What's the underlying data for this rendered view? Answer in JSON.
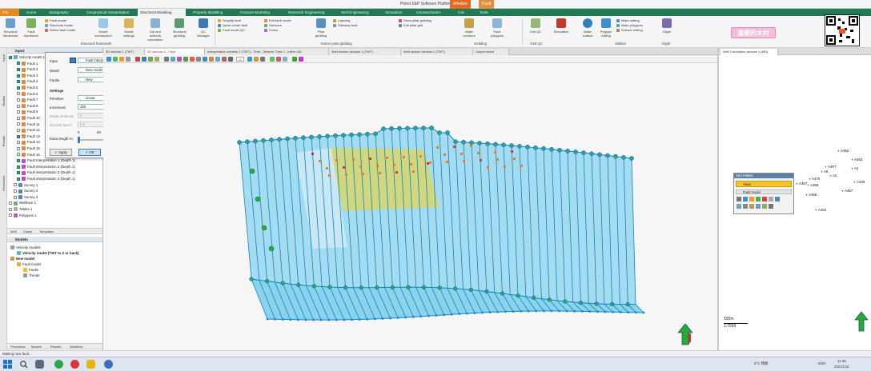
{
  "title_bar": {
    "title": "Petrel E&P Software Platform - [Video1]",
    "context_tab": "Window",
    "context_tab2": "Fault"
  },
  "menu": {
    "tabs": [
      "File",
      "Home",
      "Stratigraphy",
      "Geophysical interpretation",
      "Structural Modeling",
      "Property Modeling",
      "Fracture Modeling",
      "Reservoir Engineering",
      "Well Engineering",
      "Simulation",
      "Geomechanics",
      "GIS",
      "Tools"
    ]
  },
  "ribbon": {
    "buttons": [
      {
        "label": "Structural framework"
      },
      {
        "label": "Fault framework"
      },
      {
        "label": "Model"
      },
      {
        "label": "Model construction"
      },
      {
        "label": "Model settings"
      },
      {
        "label": "Dip and azimuth calculation"
      },
      {
        "label": "Structural gridding"
      },
      {
        "label": "QC Manager"
      }
    ],
    "small_items": [
      "Fault model",
      "Structural model",
      "Define fault model",
      "Simplify fault",
      "Quick create fault",
      "Fault model QC",
      "Edit fault model",
      "Pillar gridding",
      "Horizons",
      "Zones",
      "Layering",
      "Stairstep fault",
      "Show pillar gridding",
      "Edit pillar grid",
      "Make contours",
      "Fault polygons",
      "Surface editing",
      "Make polygons"
    ],
    "big_right": [
      {
        "label": "Pillar gridding"
      },
      {
        "label": "Grid QC"
      },
      {
        "label": "Simulation"
      },
      {
        "label": "Make surface"
      },
      {
        "label": "Polygon editing"
      },
      {
        "label": "Make editing"
      },
      {
        "label": "Glyph"
      }
    ],
    "groups": [
      "Structural framework",
      "Corner point gridding",
      "Gridding",
      "Grid QC",
      "Utilities",
      "Glyph"
    ]
  },
  "watermark": "温暖的木村",
  "side_strip": [
    "Input",
    "Models",
    "Results",
    "Processes"
  ],
  "input_panel": {
    "title": "Input",
    "items": [
      {
        "label": "Velocity model 1 (Depth 1)",
        "checked": true
      },
      {
        "label": "Fault 1",
        "checked": true
      },
      {
        "label": "Fault 2",
        "checked": true
      },
      {
        "label": "Fault 3",
        "checked": true
      },
      {
        "label": "Fault 4",
        "checked": true
      },
      {
        "label": "Fault 5",
        "checked": true
      },
      {
        "label": "Fault 6",
        "checked": false
      },
      {
        "label": "Fault 7",
        "checked": false
      },
      {
        "label": "Fault 8",
        "checked": false
      },
      {
        "label": "Fault 9",
        "checked": false
      },
      {
        "label": "Fault 10",
        "checked": false
      },
      {
        "label": "Fault 11",
        "checked": false
      },
      {
        "label": "Fault 12",
        "checked": false
      },
      {
        "label": "Fault 13",
        "checked": true
      },
      {
        "label": "Fault 14",
        "checked": false
      },
      {
        "label": "Fault 15",
        "checked": false
      },
      {
        "label": "Fault 16",
        "checked": false
      },
      {
        "label": "Fault Interpretation 1 (Depth 1)",
        "checked": true
      },
      {
        "label": "Fault interpretation 2 (Depth 1)",
        "checked": true
      },
      {
        "label": "Fault interpretation 3 (Depth 1)",
        "checked": true
      },
      {
        "label": "Fault interpretation 4 (Depth 1)",
        "checked": true
      },
      {
        "label": "Survey 1",
        "checked": false
      },
      {
        "label": "Survey 2",
        "checked": false
      },
      {
        "label": "Survey 3",
        "checked": false
      },
      {
        "label": "Wellbore 1",
        "checked": false
      },
      {
        "label": "Tables 1",
        "checked": false
      },
      {
        "label": "Polygons 1",
        "checked": false
      }
    ],
    "tabs": [
      "Well",
      "Cases",
      "Templates"
    ]
  },
  "models_panel": {
    "title": "Models",
    "items": [
      "Velocity models",
      "Velocity model [TWT to Z or back]",
      "New model",
      "Fault model",
      "Faults",
      "Trends"
    ],
    "tabs": [
      "Processes",
      "Models",
      "Results",
      "Workflow"
    ]
  },
  "dialog": {
    "input_label": "Input",
    "input_value": "Fault interpretation 1",
    "model_label": "Model",
    "model_value": "New model",
    "faults_label": "Faults",
    "faults_value": "New",
    "settings_heading": "Settings",
    "primitive_label": "Primitive:",
    "primitive_value": "Linear",
    "increment_label": "Increment:",
    "increment_value": "100",
    "depth_label": "Depth shift/unit:",
    "depth_value": "0",
    "smooth_label": "Smooth factor:",
    "smooth_value": "0.5",
    "slider_ticks": [
      "0",
      "50",
      "100"
    ],
    "extra_label": "Extra length %:",
    "apply": "Apply",
    "ok": "OK",
    "cancel": "Cancel"
  },
  "doc_tabs": [
    "3D window 1 (TWT)",
    "Interpretation window 1 (TWT) - Time - Seismic Time 2 - Inline 146",
    "Well section window 1 (TWT)",
    "Well section window 2 (TWT)",
    "Output sheet",
    "3D window 1 - Fault"
  ],
  "view_toolbar": {
    "zoom_value": "1"
  },
  "right_pane": {
    "tab": "Well Correlation window 1 (MD)",
    "wells": [
      "A492",
      "A463",
      "A4P7",
      "A8",
      "A2",
      "A470",
      "A2",
      "A487",
      "A409",
      "A456",
      "A457",
      "A458",
      "A462"
    ],
    "scale_text": "500m",
    "scale_ratio": "1:7559"
  },
  "tool_palette": {
    "title": "Tool Palette",
    "view_label": "View",
    "fault_label": "Fault model"
  },
  "status_bar": {
    "text": "Making new fault..."
  },
  "taskbar": {
    "time": "11:46",
    "date": "2021/1/12",
    "weather": "8°C 晴朗",
    "lang": "ENG"
  },
  "colors": {
    "accent": "#1f7a53",
    "fault_blue": "#2fb6e6",
    "pillar": "#1482b8",
    "selected_yellow": "#f5d322",
    "marker": "#ee7d22"
  }
}
